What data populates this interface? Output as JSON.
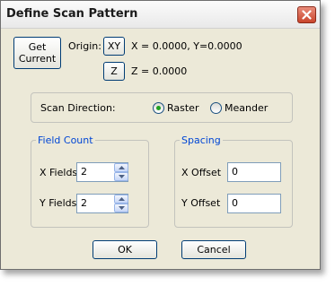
{
  "window": {
    "title": "Define Scan Pattern"
  },
  "origin": {
    "get_current_label": "Get\nCurrent",
    "label": "Origin:",
    "xy_button": "XY",
    "xy_value": "X = 0.0000, Y=0.0000",
    "z_button": "Z",
    "z_value": "Z = 0.0000"
  },
  "scan_direction": {
    "label": "Scan Direction:",
    "options": [
      "Raster",
      "Meander"
    ],
    "selected": "Raster"
  },
  "field_count": {
    "legend": "Field Count",
    "x_label": "X Fields",
    "x_value": "2",
    "y_label": "Y Fields",
    "y_value": "2"
  },
  "spacing": {
    "legend": "Spacing",
    "x_label": "X Offset",
    "x_value": "0",
    "y_label": "Y Offset",
    "y_value": "0"
  },
  "buttons": {
    "ok": "OK",
    "cancel": "Cancel"
  },
  "colors": {
    "accent": "#0046d5",
    "close": "#c9452c",
    "dialog_bg": "#ece9d8"
  }
}
